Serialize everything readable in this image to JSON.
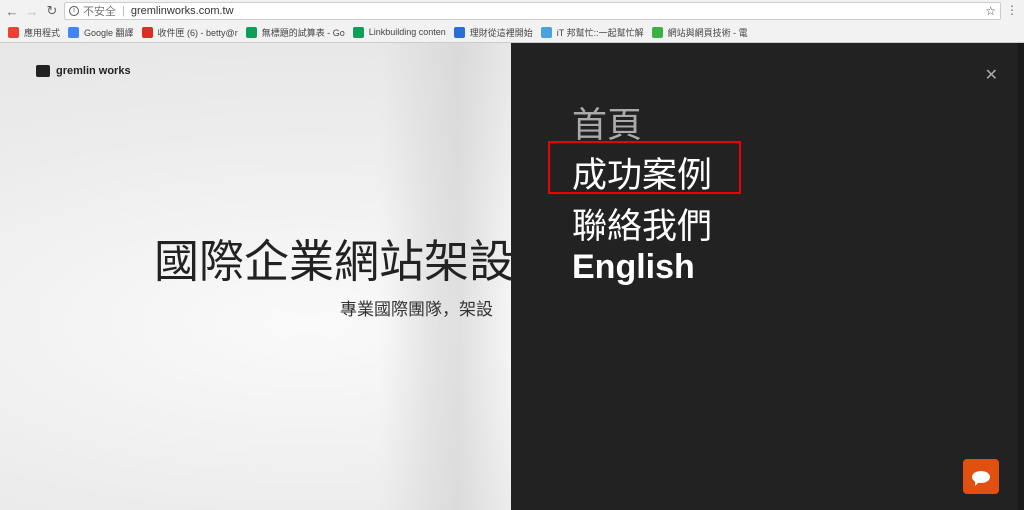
{
  "browser": {
    "insecure_label": "不安全",
    "url": "gremlinworks.com.tw",
    "bookmarks": [
      {
        "label": "應用程式",
        "icon": "apps-grid-icon",
        "color": "#e94235"
      },
      {
        "label": "Google 翻譯",
        "icon": "google-translate-icon",
        "color": "#4285f4"
      },
      {
        "label": "收件匣 (6) - betty@r",
        "icon": "gmail-icon",
        "color": "#d93025"
      },
      {
        "label": "無標題的試算表 - Go",
        "icon": "sheets-icon",
        "color": "#0f9d58"
      },
      {
        "label": "Linkbuilding conten",
        "icon": "sheets-icon",
        "color": "#0f9d58"
      },
      {
        "label": "理財從這裡開始",
        "icon": "edit-icon",
        "color": "#2a6fd6"
      },
      {
        "label": "iT 邦幫忙::一起幫忙解",
        "icon": "ithome-icon",
        "color": "#4aa3df"
      },
      {
        "label": "網站與網頁技術 - 電",
        "icon": "site-icon",
        "color": "#3cb043"
      }
    ]
  },
  "site": {
    "logo": "gremlin works",
    "hero_title": "國際企業網站架設",
    "hero_subtitle": "專業國際團隊，架設"
  },
  "menu": {
    "items": [
      "首頁",
      "成功案例",
      "聯絡我們",
      "English"
    ],
    "highlighted": "成功案例",
    "highlight_color": "#e00000"
  },
  "chat": {
    "icon": "chat-bubble-icon",
    "color": "#e2500f"
  }
}
